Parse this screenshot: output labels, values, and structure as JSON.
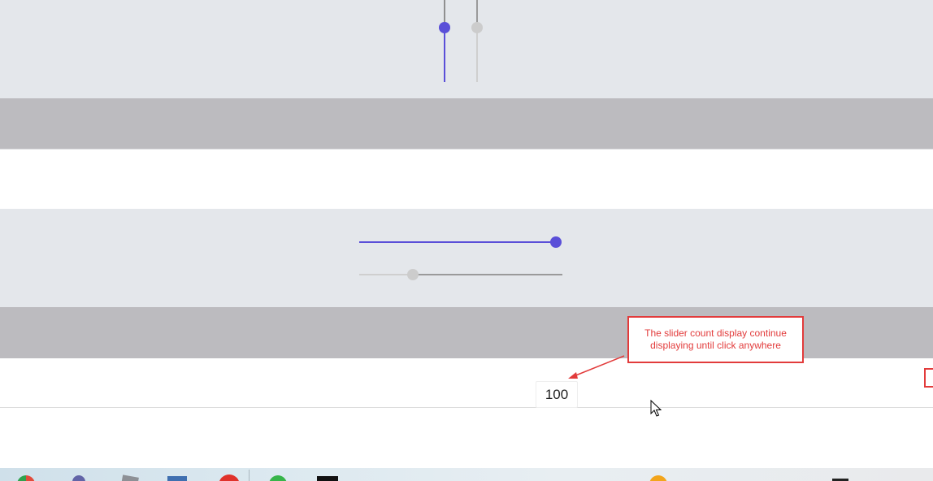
{
  "slider_value_display": "100",
  "annotation": {
    "text": "The slider count display continue displaying until click anywhere"
  },
  "colors": {
    "accent": "#5a4fd8",
    "inactive": "#c8c8c8",
    "annotation_red": "#e23b3b",
    "panel_light": "#e4e7eb",
    "panel_dark": "#bcbbbf"
  },
  "sliders": {
    "vertical_active": {
      "state": "enabled",
      "orientation": "vertical"
    },
    "vertical_disabled": {
      "state": "disabled",
      "orientation": "vertical"
    },
    "horizontal_active": {
      "state": "enabled",
      "orientation": "horizontal",
      "value_percent": 100
    },
    "horizontal_disabled": {
      "state": "disabled",
      "orientation": "horizontal",
      "value_percent": 27
    }
  },
  "taskbar": {
    "icons": [
      "chrome-icon",
      "teams-icon",
      "pen-icon",
      "window-icon",
      "red-app-icon",
      "green-app-icon",
      "black-app-icon",
      "orange-app-icon",
      "dark-app-icon"
    ]
  }
}
